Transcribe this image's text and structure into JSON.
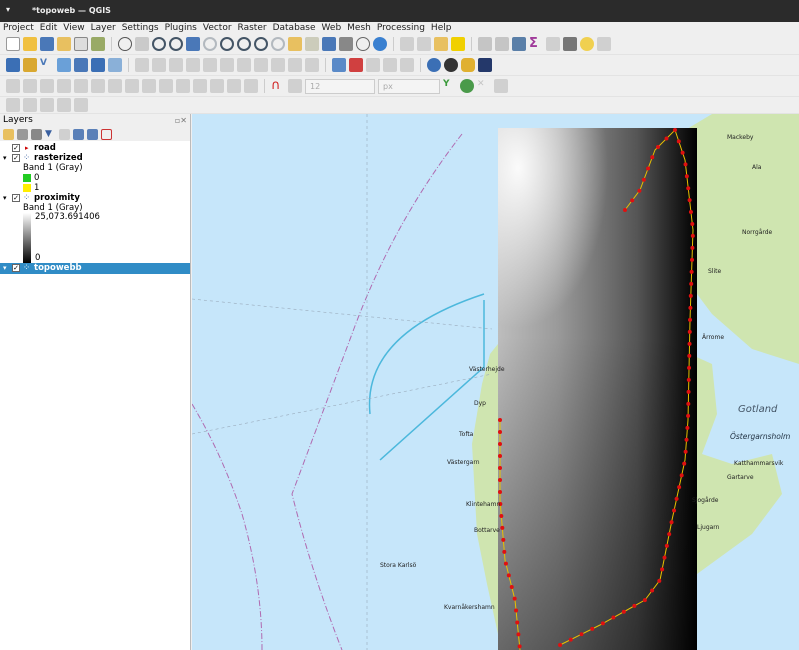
{
  "window": {
    "title": "*topoweb — QGIS"
  },
  "menu": [
    "Project",
    "Edit",
    "View",
    "Layer",
    "Settings",
    "Plugins",
    "Vector",
    "Raster",
    "Database",
    "Web",
    "Mesh",
    "Processing",
    "Help"
  ],
  "toolbar": {
    "font_size": "12",
    "unit": "px"
  },
  "layers_panel": {
    "title": "Layers",
    "layers": [
      {
        "name": "road",
        "checked": true
      },
      {
        "name": "rasterized",
        "checked": true,
        "band": "Band 1 (Gray)",
        "legend": [
          {
            "label": "0",
            "color": "#22cc22"
          },
          {
            "label": "1",
            "color": "#ffee00"
          }
        ]
      },
      {
        "name": "proximity",
        "checked": true,
        "band": "Band 1 (Gray)",
        "max": "25,073.691406",
        "min": "0"
      },
      {
        "name": "topowebb",
        "checked": true,
        "selected": true
      }
    ]
  },
  "map": {
    "labels": [
      "Mackeby",
      "Ala",
      "Norrgårde",
      "Slite",
      "Ärrome",
      "Gotland",
      "Östergarnsholm",
      "Katthammarsvik",
      "Gartarve",
      "Ljugarn",
      "Västerhejde",
      "Dyp",
      "Tofta",
      "Västergarn",
      "Klintehamn",
      "Bottarve",
      "Stora Karlsö",
      "Kvarnåkershamn",
      "Sjogårde"
    ]
  }
}
